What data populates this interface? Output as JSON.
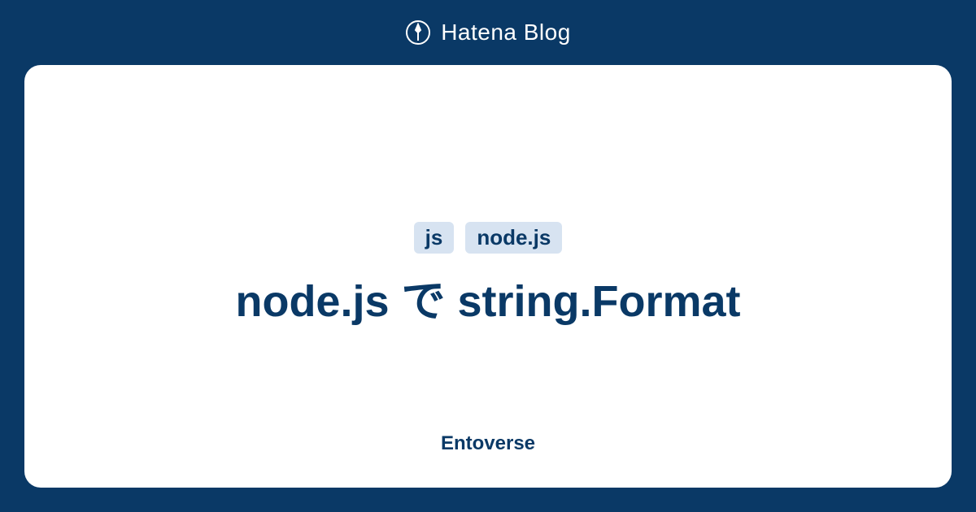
{
  "header": {
    "brand": "Hatena Blog"
  },
  "card": {
    "tags": [
      "js",
      "node.js"
    ],
    "title": "node.js で string.Format",
    "author": "Entoverse"
  },
  "colors": {
    "background": "#0a3966",
    "card_bg": "#ffffff",
    "tag_bg": "#d7e3f1",
    "text_primary": "#0a3966"
  }
}
